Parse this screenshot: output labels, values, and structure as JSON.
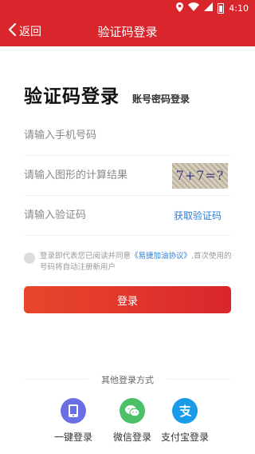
{
  "status_bar": {
    "time": "4:10"
  },
  "nav": {
    "back_label": "返回",
    "title": "验证码登录"
  },
  "heading": {
    "title": "验证码登录",
    "alt_login": "账号密码登录"
  },
  "form": {
    "phone_placeholder": "请输入手机号码",
    "captcha_placeholder": "请输入图形的计算结果",
    "captcha_text": "7+7=?",
    "code_placeholder": "请输入验证码",
    "get_code_label": "获取验证码"
  },
  "agreement": {
    "prefix": "登录即代表您已阅读并同意",
    "link": "《易捷加油协议》",
    "suffix": ",首次使用的号码将自动注册新用户"
  },
  "login_button": "登录",
  "other_login": {
    "title": "其他登录方式",
    "options": [
      {
        "label": "一键登录",
        "icon": "phone-icon",
        "color": "#6b6fe6"
      },
      {
        "label": "微信登录",
        "icon": "wechat-icon",
        "color": "#4cbf69"
      },
      {
        "label": "支付宝登录",
        "icon": "alipay-icon",
        "color": "#1a9be8"
      }
    ]
  },
  "colors": {
    "primary": "#d9262c",
    "link": "#2f7fd8"
  }
}
